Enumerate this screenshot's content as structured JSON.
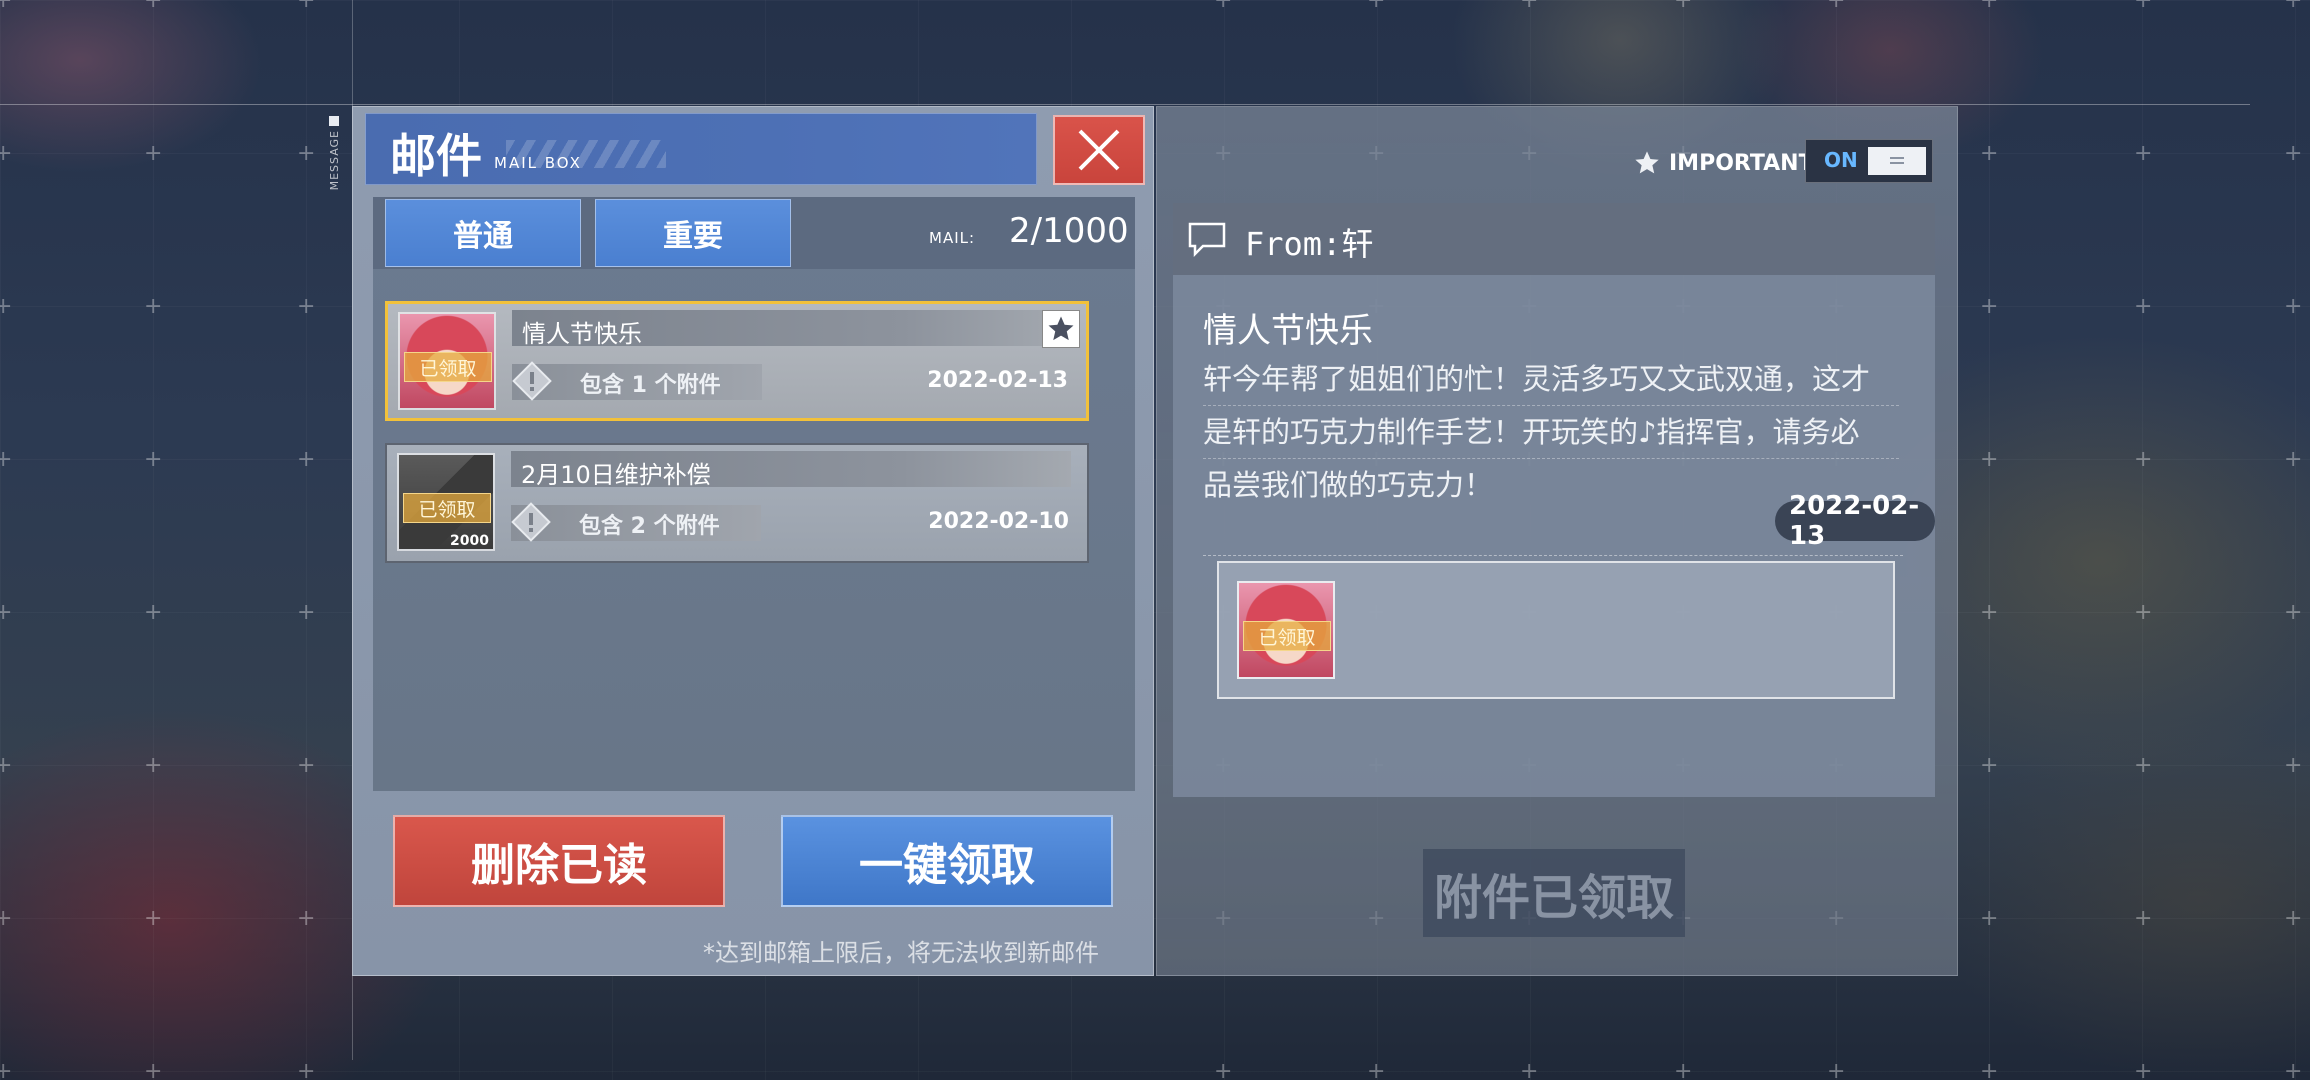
{
  "side_label": "MESSAGE",
  "header": {
    "title": "邮件",
    "subtitle": "MAIL BOX"
  },
  "tabs": [
    {
      "label": "普通"
    },
    {
      "label": "重要"
    }
  ],
  "mail_count": {
    "label": "MAIL:",
    "value": "2/1000"
  },
  "mails": [
    {
      "title": "情人节快乐",
      "claimed_label": "已领取",
      "attachments": "包含 1 个附件",
      "date": "2022-02-13",
      "starred": true,
      "selected": true,
      "thumb_icon": "character-portrait-icon"
    },
    {
      "title": "2月10日维护补偿",
      "claimed_label": "已领取",
      "attachments": "包含 2 个附件",
      "date": "2022-02-10",
      "starred": false,
      "selected": false,
      "thumb_icon": "chip-item-icon",
      "thumb_count": "2000"
    }
  ],
  "buttons": {
    "delete_read": "删除已读",
    "claim_all": "一键领取",
    "claimed": "附件已领取"
  },
  "limit_note": "*达到邮箱上限后，将无法收到新邮件",
  "important_toggle": {
    "label": "IMPORTANT",
    "state": "ON"
  },
  "detail": {
    "from": "From:轩",
    "title": "情人节快乐",
    "body_lines": [
      "轩今年帮了姐姐们的忙！灵活多巧又文武双通，这才",
      "是轩的巧克力制作手艺！开玩笑的♪指挥官，请务必",
      "品尝我们做的巧克力！"
    ],
    "date": "2022-02-13",
    "attachment_claimed_label": "已领取"
  },
  "colors": {
    "accent_blue": "#4a7fd0",
    "accent_red": "#d9574c",
    "highlight_gold": "#f2c13a",
    "toggle_on": "#68b8ff"
  }
}
